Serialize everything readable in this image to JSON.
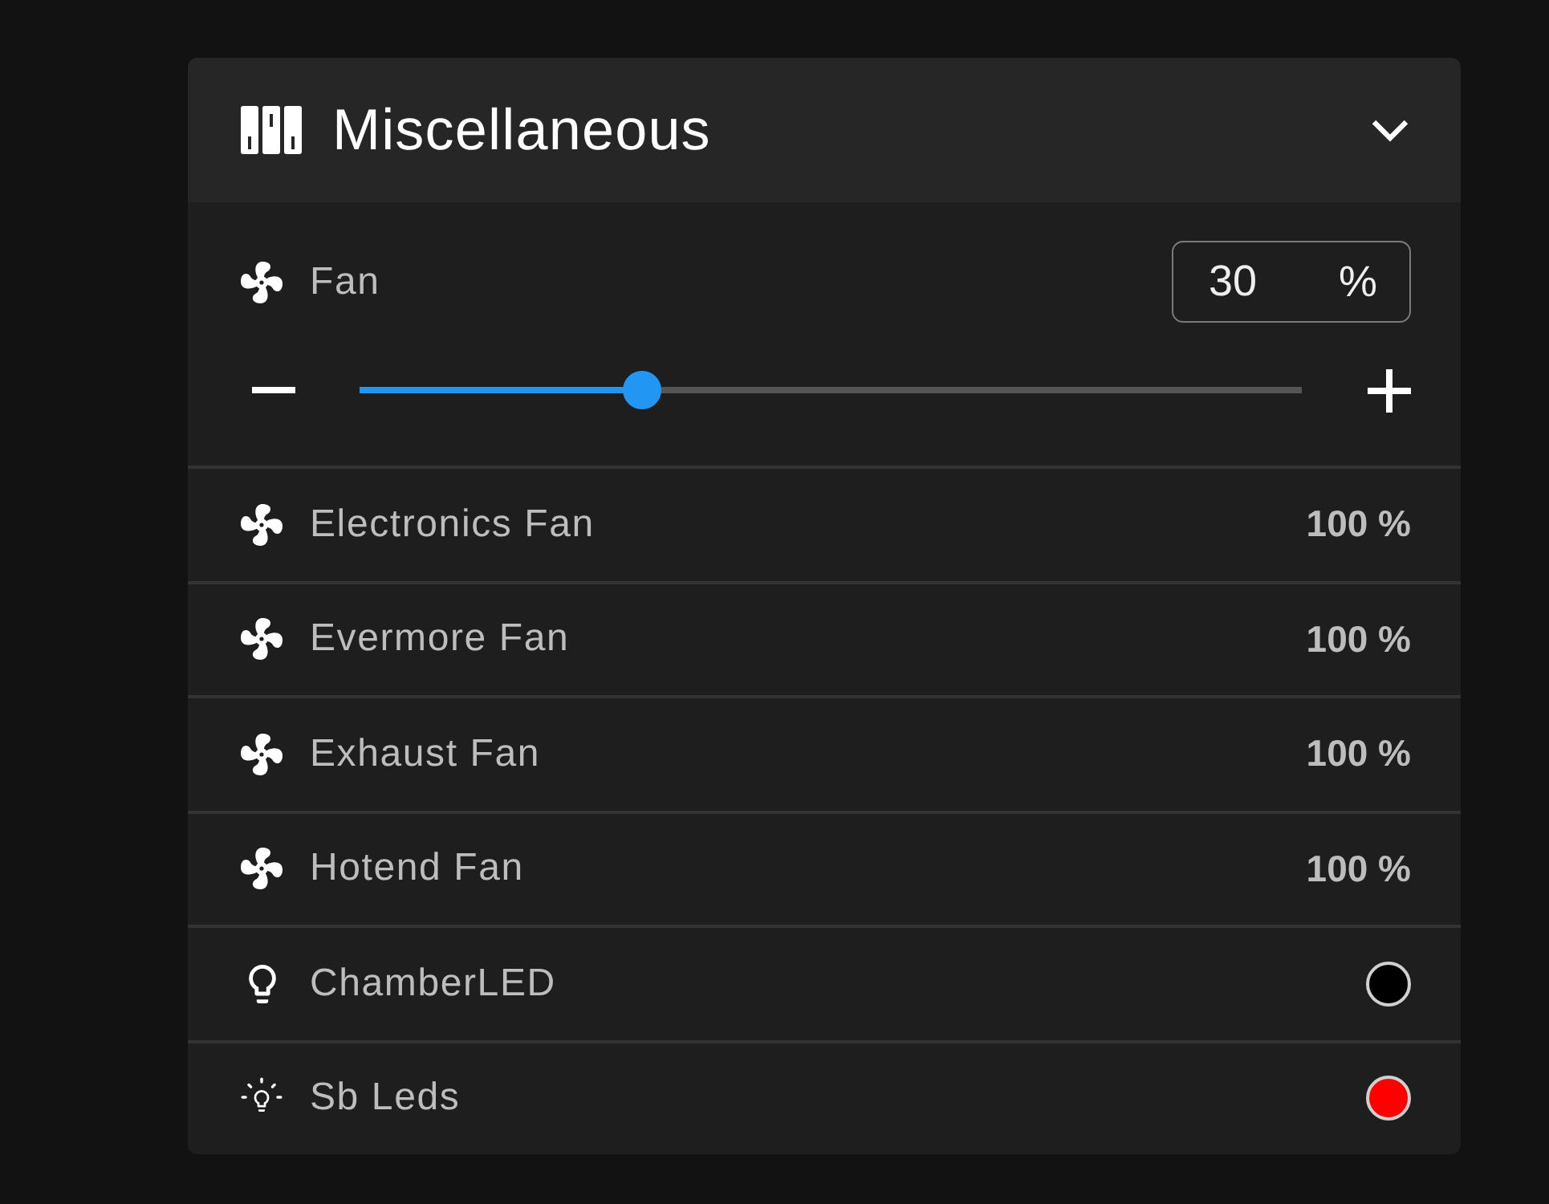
{
  "panel": {
    "title": "Miscellaneous",
    "expanded": true
  },
  "fan_control": {
    "label": "Fan",
    "value": "30",
    "unit": "%",
    "level": 0.3
  },
  "fans": [
    {
      "label": "Electronics Fan",
      "reading": "100 %"
    },
    {
      "label": "Evermore Fan",
      "reading": "100 %"
    },
    {
      "label": "Exhaust Fan",
      "reading": "100 %"
    },
    {
      "label": "Hotend Fan",
      "reading": "100 %"
    }
  ],
  "lights": [
    {
      "label": "ChamberLED",
      "on": false,
      "color": "#000000"
    },
    {
      "label": "Sb Leds",
      "on": true,
      "color": "#ff0000"
    }
  ]
}
